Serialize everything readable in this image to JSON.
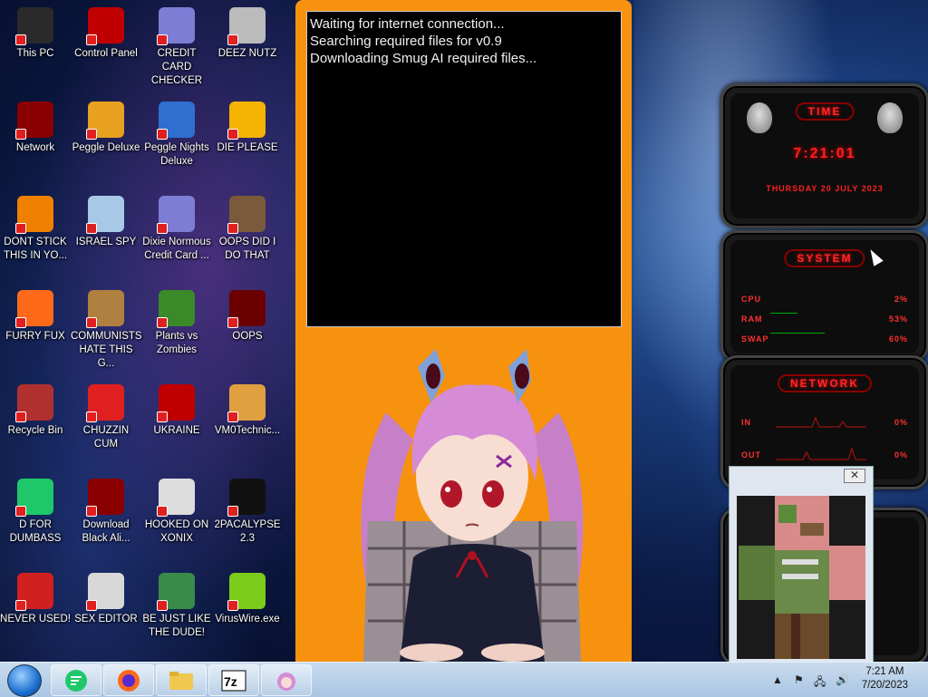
{
  "desktop": {
    "icons": [
      {
        "label": "This PC",
        "icon": "computer-icon",
        "color": "#2a2a2a"
      },
      {
        "label": "Control Panel",
        "icon": "control-panel-icon",
        "color": "#c00000"
      },
      {
        "label": "CREDIT CARD CHECKER",
        "icon": "credit-card-icon",
        "color": "#7d7dd6"
      },
      {
        "label": "DEEZ NUTZ",
        "icon": "stacked-windows-icon",
        "color": "#bbbbbb"
      },
      {
        "label": "Network",
        "icon": "alien-network-icon",
        "color": "#8a0000"
      },
      {
        "label": "Peggle Deluxe",
        "icon": "peggle-icon",
        "color": "#e8a020"
      },
      {
        "label": "Peggle Nights Deluxe",
        "icon": "peggle-nights-icon",
        "color": "#2f6fd0"
      },
      {
        "label": "DIE PLEASE",
        "icon": "die-icon",
        "color": "#f3b300"
      },
      {
        "label": "DONT STICK THIS IN YO...",
        "icon": "vlc-cone-icon",
        "color": "#f08000"
      },
      {
        "label": "ISRAEL SPY",
        "icon": "remote-desktop-icon",
        "color": "#a8c8e8"
      },
      {
        "label": "Dixie Normous Credit Card ...",
        "icon": "credit-card-icon",
        "color": "#7d7dd6"
      },
      {
        "label": "OOPS DID I DO THAT",
        "icon": "portrait-icon",
        "color": "#7a5a3a"
      },
      {
        "label": "FURRY FUX",
        "icon": "firefox-icon",
        "color": "#ff6a1a"
      },
      {
        "label": "COMMUNISTS HATE THIS G...",
        "icon": "money-bag-icon",
        "color": "#b08040"
      },
      {
        "label": "Plants vs Zombies",
        "icon": "flower-icon",
        "color": "#3a8a2a"
      },
      {
        "label": "OOPS",
        "icon": "red-book-icon",
        "color": "#6a0000"
      },
      {
        "label": "Recycle Bin",
        "icon": "recycle-bin-icon",
        "color": "#b03030"
      },
      {
        "label": "CHUZZIN CUM",
        "icon": "chuzzle-icon",
        "color": "#e02020"
      },
      {
        "label": "UKRAINE",
        "icon": "radiation-icon",
        "color": "#c00000"
      },
      {
        "label": "VM0Technic...",
        "icon": "doctor-icon",
        "color": "#e0a040"
      },
      {
        "label": "D FOR DUMBASS",
        "icon": "chat-bubble-icon",
        "color": "#1ec86a"
      },
      {
        "label": "Download Black Ali...",
        "icon": "alien-orb-icon",
        "color": "#8a0000"
      },
      {
        "label": "HOOKED ON XONIX",
        "icon": "xonix-icon",
        "color": "#dddddd"
      },
      {
        "label": "2PACALYPSE 2.3",
        "icon": "terminal-icon",
        "color": "#111111"
      },
      {
        "label": "NEVER USED!",
        "icon": "devcpp-icon",
        "color": "#d02020"
      },
      {
        "label": "SEX EDITOR",
        "icon": "hxd-icon",
        "color": "#d8d8d8"
      },
      {
        "label": "BE JUST LIKE THE DUDE!",
        "icon": "santa-icon",
        "color": "#3a8a4a"
      },
      {
        "label": "VirusWire.exe",
        "icon": "limewire-icon",
        "color": "#7acb1a"
      }
    ]
  },
  "app": {
    "console_lines": [
      "Waiting for internet connection...",
      "Searching required files for v0.9",
      "Downloading Smug AI required files..."
    ],
    "background": "#f7920f"
  },
  "widgets": {
    "time": {
      "title": "TIME",
      "clock": "7:21:01",
      "date": "THURSDAY 20 JULY 2023"
    },
    "system": {
      "title": "SYSTEM",
      "rows": [
        {
          "label": "CPU",
          "value": "2%"
        },
        {
          "label": "RAM",
          "value": "53%"
        },
        {
          "label": "SWAP",
          "value": "60%"
        }
      ]
    },
    "network": {
      "title": "NETWORK",
      "rows": [
        {
          "label": "IN",
          "value": "0%"
        },
        {
          "label": "OUT",
          "value": "0%"
        }
      ]
    },
    "accent": "#ff2020"
  },
  "popup": {
    "close_label": "✕"
  },
  "taskbar": {
    "pinned": [
      "chat-app",
      "firefox",
      "file-explorer",
      "7-zip",
      "smug-ai"
    ],
    "clock_time": "7:21 AM",
    "clock_date": "7/20/2023"
  }
}
